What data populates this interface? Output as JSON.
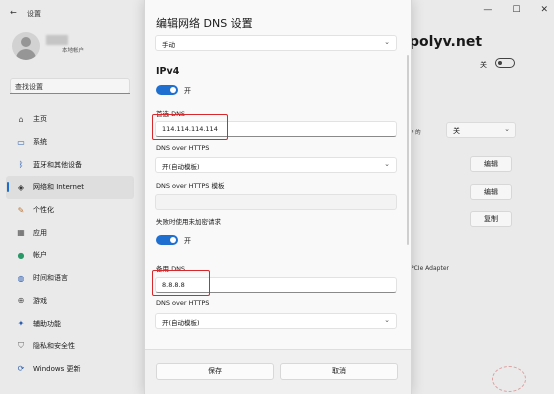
{
  "window": {
    "title": "设置",
    "controls": [
      "—",
      "☐",
      "✕"
    ]
  },
  "user": {
    "type_label": "本地帐户"
  },
  "search": {
    "placeholder": "查找设置"
  },
  "sidebar": {
    "items": [
      {
        "label": "主页",
        "icon": "home-icon"
      },
      {
        "label": "系统",
        "icon": "system-icon"
      },
      {
        "label": "蓝牙和其他设备",
        "icon": "bluetooth-icon"
      },
      {
        "label": "网络和 Internet",
        "icon": "wifi-icon",
        "active": true
      },
      {
        "label": "个性化",
        "icon": "brush-icon"
      },
      {
        "label": "应用",
        "icon": "apps-icon"
      },
      {
        "label": "帐户",
        "icon": "account-icon"
      },
      {
        "label": "时间和语言",
        "icon": "globe-icon"
      },
      {
        "label": "游戏",
        "icon": "game-icon"
      },
      {
        "label": "辅助功能",
        "icon": "accessibility-icon"
      },
      {
        "label": "隐私和安全性",
        "icon": "shield-icon"
      },
      {
        "label": "Windows 更新",
        "icon": "update-icon"
      }
    ]
  },
  "background_content": {
    "domain_partial": "polyv.net",
    "toggle_label": "关",
    "row_partial_label": "P 的",
    "select_value": "关",
    "edit_button_1": "编辑",
    "edit_button_2": "编辑",
    "copy_button": "复制",
    "adapter_partial": "PCIe Adapter"
  },
  "dialog": {
    "title": "编辑网络 DNS 设置",
    "mode_value": "手动",
    "section_title": "IPv4",
    "ipv4_toggle_label": "开",
    "preferred_dns_label": "首选 DNS",
    "preferred_dns_value": "114.114.114.114",
    "doh_label": "DNS over HTTPS",
    "doh_value": "开(自动模板)",
    "doh_template_label": "DNS over HTTPS 模板",
    "doh_template_value": "",
    "fallback_label": "失败时使用未加密请求",
    "fallback_toggle_label": "开",
    "alternate_dns_label": "备用 DNS",
    "alternate_dns_value": "8.8.8.8",
    "alt_doh_label": "DNS over HTTPS",
    "alt_doh_value": "开(自动模板)",
    "save_label": "保存",
    "cancel_label": "取消"
  },
  "colors": {
    "accent": "#1f6fd1",
    "highlight": "#d8282c"
  }
}
